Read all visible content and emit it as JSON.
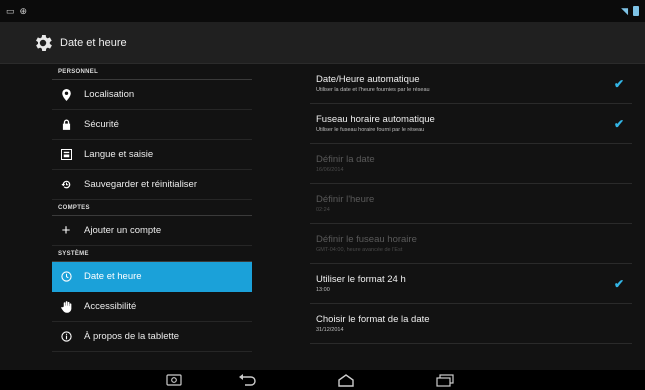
{
  "status_bar": {},
  "action_bar": {
    "title": "Date et heure",
    "icon": "settings-gear-icon"
  },
  "left_pane": {
    "sections": [
      {
        "header": "PERSONNEL",
        "items": [
          {
            "label": "Localisation",
            "icon": "location-pin-icon"
          },
          {
            "label": "Sécurité",
            "icon": "lock-icon"
          },
          {
            "label": "Langue et saisie",
            "icon": "keyboard-icon"
          },
          {
            "label": "Sauvegarder et réinitialiser",
            "icon": "backup-icon"
          }
        ]
      },
      {
        "header": "COMPTES",
        "items": [
          {
            "label": "Ajouter un compte",
            "icon": "plus-icon"
          }
        ]
      },
      {
        "header": "SYSTÈME",
        "items": [
          {
            "label": "Date et heure",
            "icon": "clock-icon",
            "selected": true
          },
          {
            "label": "Accessibilité",
            "icon": "hand-icon"
          },
          {
            "label": "À propos de la tablette",
            "icon": "info-icon"
          }
        ]
      }
    ]
  },
  "settings": [
    {
      "title": "Date/Heure automatique",
      "summary": "Utiliser la date et l'heure fournies par le réseau",
      "checked": true,
      "enabled": true
    },
    {
      "title": "Fuseau horaire automatique",
      "summary": "Utiliser le fuseau horaire fourni par le réseau",
      "checked": true,
      "enabled": true
    },
    {
      "title": "Définir la date",
      "summary": "16/06/2014",
      "checked": false,
      "enabled": false
    },
    {
      "title": "Définir l'heure",
      "summary": "02:24",
      "checked": false,
      "enabled": false
    },
    {
      "title": "Définir le fuseau horaire",
      "summary": "GMT-04:00, heure avancée de l'Est",
      "checked": false,
      "enabled": false
    },
    {
      "title": "Utiliser le format 24 h",
      "summary": "13:00",
      "checked": true,
      "enabled": true
    },
    {
      "title": "Choisir le format de la date",
      "summary": "31/12/2014",
      "checked": false,
      "enabled": true
    }
  ],
  "colors": {
    "accent": "#1ba1d9",
    "check": "#33b5e5",
    "background": "#121212"
  },
  "nav_bar": {
    "buttons": [
      "screenshot-icon",
      "back-icon",
      "home-icon",
      "recent-apps-icon"
    ]
  }
}
